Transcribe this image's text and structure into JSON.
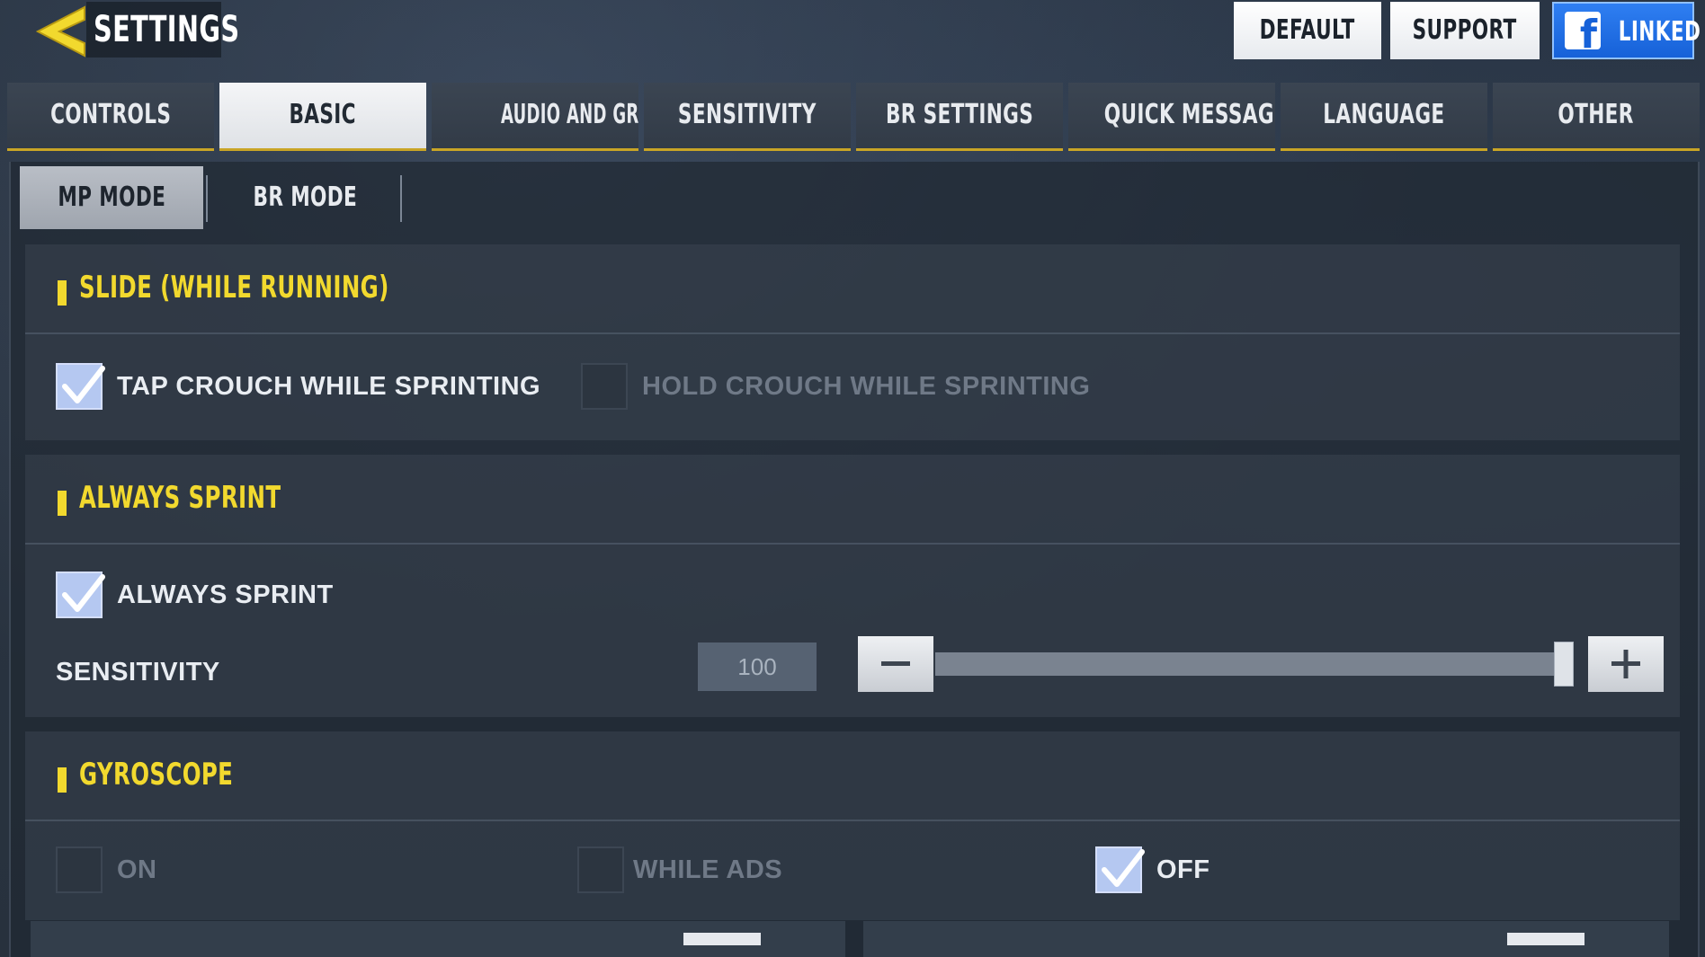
{
  "header": {
    "title": "SETTINGS",
    "buttons": {
      "default": "DEFAULT",
      "support": "SUPPORT",
      "linked": "LINKED"
    },
    "icons": {
      "back": "back-arrow-icon",
      "facebook": "facebook-icon"
    }
  },
  "tabs": [
    {
      "label": "CONTROLS",
      "active": false
    },
    {
      "label": "BASIC",
      "active": true
    },
    {
      "label": "AUDIO AND GRAPHICS",
      "active": false
    },
    {
      "label": "SENSITIVITY",
      "active": false
    },
    {
      "label": "BR SETTINGS",
      "active": false
    },
    {
      "label": "QUICK MESSAGE",
      "active": false
    },
    {
      "label": "LANGUAGE",
      "active": false
    },
    {
      "label": "OTHER",
      "active": false
    }
  ],
  "subtabs": [
    {
      "label": "MP MODE",
      "active": true
    },
    {
      "label": "BR MODE",
      "active": false
    }
  ],
  "sections": {
    "slide": {
      "title": "SLIDE (WHILE RUNNING)",
      "options": [
        {
          "label": "TAP CROUCH WHILE SPRINTING",
          "checked": true
        },
        {
          "label": "HOLD CROUCH WHILE SPRINTING",
          "checked": false
        }
      ]
    },
    "always_sprint": {
      "title": "ALWAYS SPRINT",
      "option": {
        "label": "ALWAYS SPRINT",
        "checked": true
      },
      "sensitivity": {
        "label": "SENSITIVITY",
        "value": "100",
        "level": 1.0
      }
    },
    "gyroscope": {
      "title": "GYROSCOPE",
      "options": [
        {
          "label": "ON",
          "checked": false
        },
        {
          "label": "WHILE ADS",
          "checked": false
        },
        {
          "label": "OFF",
          "checked": true
        }
      ]
    }
  },
  "colors": {
    "accent_yellow": "#f2d92e",
    "tab_underline": "#c9a526",
    "checkbox_checked": "#b5c8f1",
    "linked_blue": "#1661d8"
  }
}
